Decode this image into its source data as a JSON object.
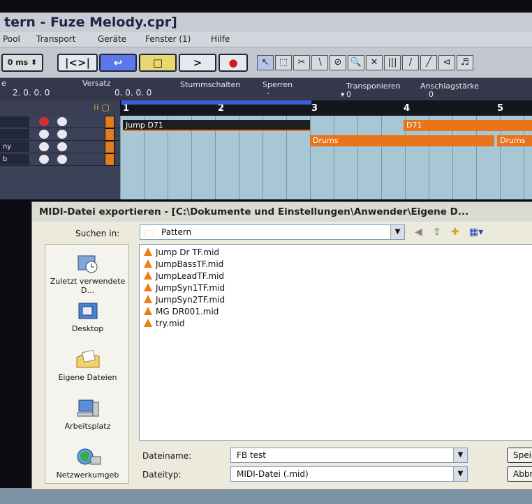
{
  "window": {
    "title": "tern - Fuze Melody.cpr]"
  },
  "menu": {
    "items": [
      "Pool",
      "Transport",
      "Geräte",
      "Fenster (1)",
      "Hilfe"
    ]
  },
  "toolbar": {
    "time_field": "0 ms",
    "buttons": [
      "|<>|",
      "↩",
      "□",
      ">",
      "●"
    ],
    "tools": [
      "↖",
      "⬚",
      "✂",
      "∖",
      "⊘",
      "🔍",
      "✕",
      "|||",
      "/",
      "╱",
      "⊲",
      "♬"
    ]
  },
  "infobar": {
    "label_left": "e",
    "value_left": "2. 0. 0.   0",
    "versatz_label": "Versatz",
    "versatz_value": "0. 0. 0.   0",
    "mute_label": "Stummschalten",
    "lock_label": "Sperren",
    "lock_value": "-",
    "transpose_label": "Transponieren",
    "transpose_value": "0",
    "velocity_label": "Anschlagstärke",
    "velocity_value": "0"
  },
  "ruler": {
    "marks": [
      "1",
      "2",
      "3",
      "4",
      "5"
    ]
  },
  "tracks": [
    {
      "name": ""
    },
    {
      "name": ""
    },
    {
      "name": "ny"
    },
    {
      "name": "b"
    }
  ],
  "parts": [
    {
      "label": "Jump D71"
    },
    {
      "label": "D71"
    },
    {
      "label": "Drums"
    },
    {
      "label": "Drums"
    }
  ],
  "dialog": {
    "title": "MIDI-Datei exportieren - [C:\\Dokumente und Einstellungen\\Anwender\\Eigene D...",
    "look_in_label": "Suchen in:",
    "look_in_value": "Pattern",
    "places": [
      {
        "label": "Zuletzt verwendete D...",
        "icon": "recent-icon"
      },
      {
        "label": "Desktop",
        "icon": "desktop-icon"
      },
      {
        "label": "Eigene Dateien",
        "icon": "my-documents-icon"
      },
      {
        "label": "Arbeitsplatz",
        "icon": "my-computer-icon"
      },
      {
        "label": "Netzwerkumgeb",
        "icon": "network-icon"
      }
    ],
    "files": [
      "Jump Dr TF.mid",
      "JumpBassTF.mid",
      "JumpLeadTF.mid",
      "JumpSyn1TF.mid",
      "JumpSyn2TF.mid",
      "MG DR001.mid",
      "try.mid"
    ],
    "filename_label": "Dateiname:",
    "filename_value": "FB test",
    "filetype_label": "Dateityp:",
    "filetype_value": "MIDI-Datei (.mid)",
    "save_button": "Speichern",
    "cancel_button": "Abbrechen"
  },
  "colors": {
    "part_orange": "#e8741c",
    "part_dark": "#1e1e22",
    "accent_blue": "#3f5bd6"
  }
}
